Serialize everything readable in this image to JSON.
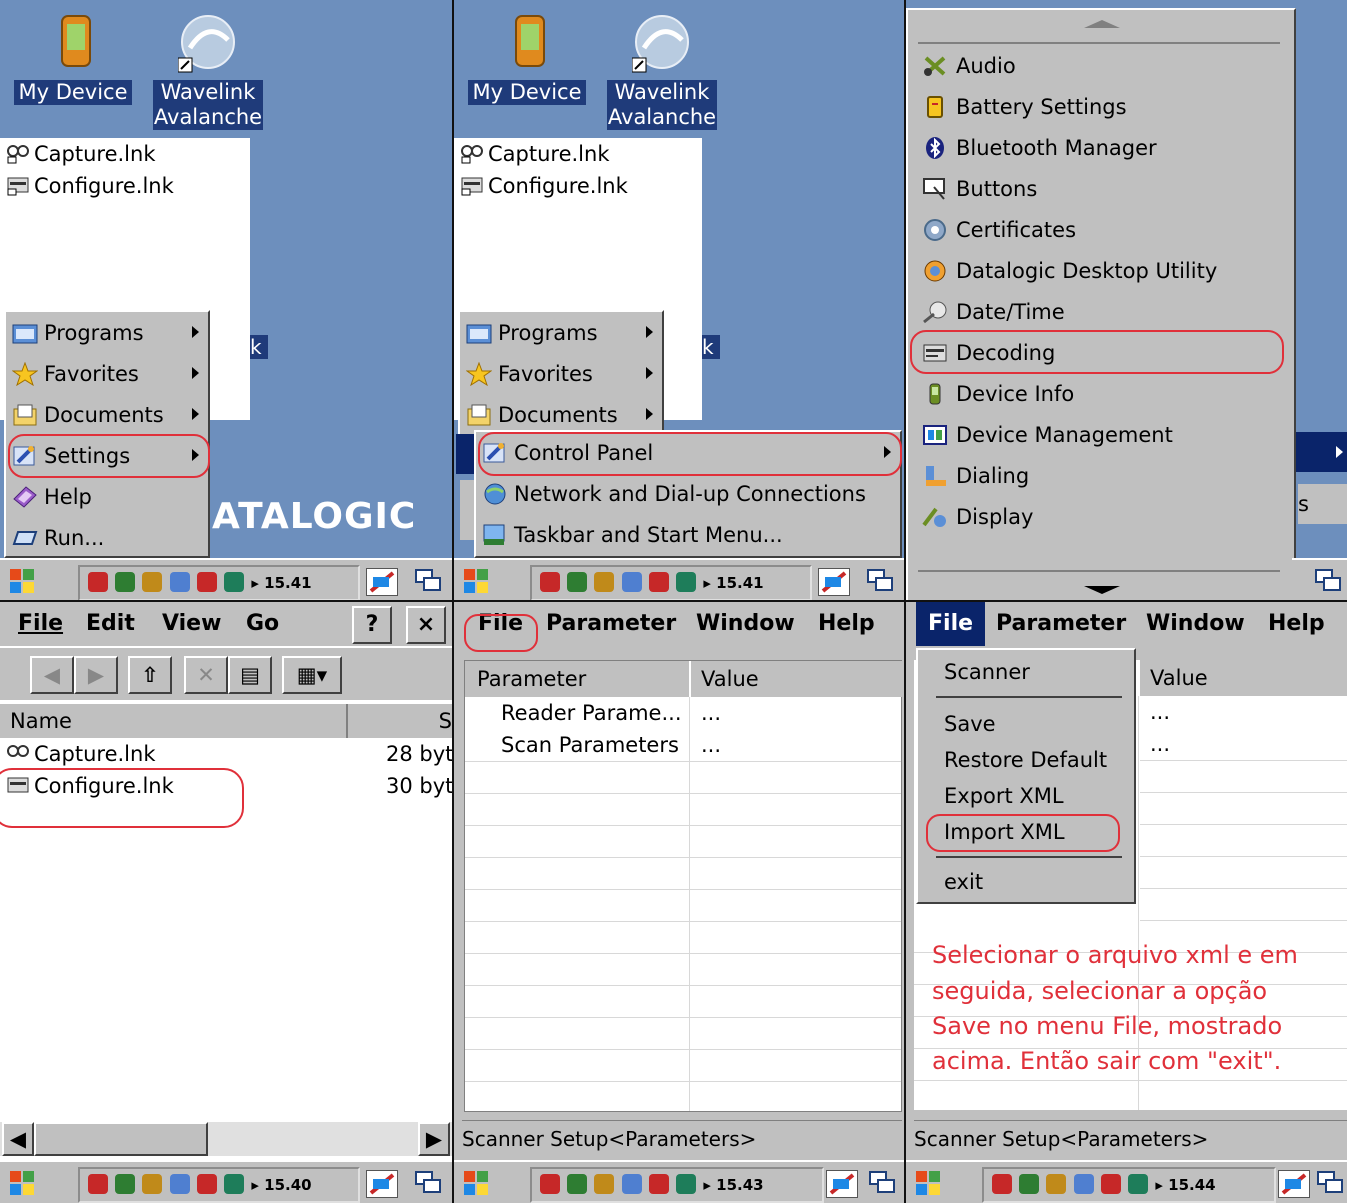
{
  "desktop": {
    "icons": [
      {
        "label": "My Device"
      },
      {
        "label_line1": "Wavelink",
        "label_line2": "Avalanche"
      }
    ],
    "files": [
      "Capture.lnk",
      "Configure.lnk"
    ],
    "brand": "DATALOGIC",
    "brand_partial": "ATALOGIC",
    "clipped_char": "k"
  },
  "start_menu": {
    "items": [
      "Programs",
      "Favorites",
      "Documents",
      "Settings",
      "Help",
      "Run..."
    ]
  },
  "settings_submenu": {
    "items": [
      "Control Panel",
      "Network and Dial-up Connections",
      "Taskbar and Start Menu..."
    ]
  },
  "control_panel": {
    "items": [
      "Audio",
      "Battery Settings",
      "Bluetooth Manager",
      "Buttons",
      "Certificates",
      "Datalogic Desktop Utility",
      "Date/Time",
      "Decoding",
      "Device Info",
      "Device Management",
      "Dialing",
      "Display"
    ],
    "highlighted": "Decoding",
    "clipped_text": "s"
  },
  "taskbars": [
    {
      "time": "15.41"
    },
    {
      "time": "15.41"
    },
    {
      "time": "15.40"
    },
    {
      "time": "15.43"
    },
    {
      "time": "15.44"
    }
  ],
  "explorer": {
    "menu": [
      "File",
      "Edit",
      "View",
      "Go"
    ],
    "help_btn": "?",
    "close_btn": "×",
    "columns": [
      "Name",
      "S"
    ],
    "rows": [
      {
        "name": "Capture.lnk",
        "size": "28 byt"
      },
      {
        "name": "Configure.lnk",
        "size": "30 byt"
      }
    ]
  },
  "scanner_setup": {
    "menu": [
      "File",
      "Parameter",
      "Window",
      "Help"
    ],
    "columns": [
      "Parameter",
      "Value"
    ],
    "rows": [
      {
        "param": "Reader Parame...",
        "value": "..."
      },
      {
        "param": "Scan Parameters",
        "value": "..."
      }
    ],
    "status": "Scanner Setup<Parameters>",
    "file_menu": [
      "Scanner",
      "Save",
      "Restore Default",
      "Export XML",
      "Import XML",
      "exit"
    ]
  },
  "annotation": {
    "lines": [
      "Selecionar o arquivo xml e em",
      "seguida, selecionar a opção",
      "Save no menu File, mostrado",
      "acima. Então sair com \"exit\"."
    ]
  }
}
